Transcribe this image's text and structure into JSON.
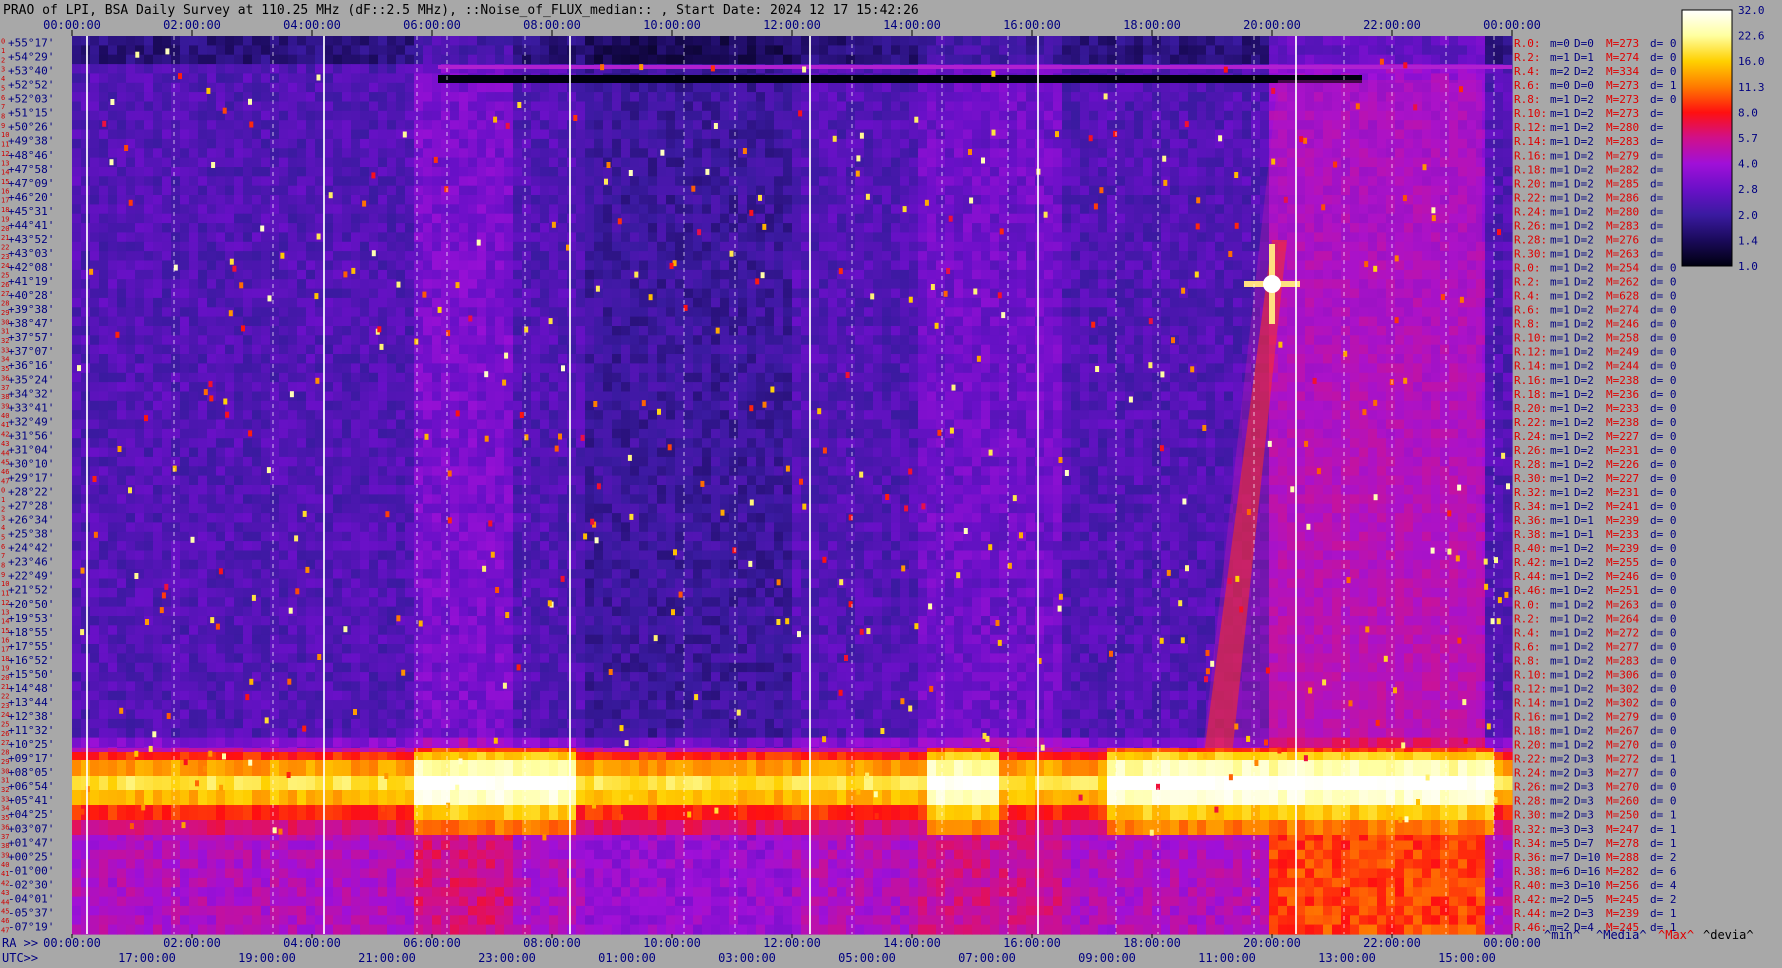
{
  "chart_data": {
    "type": "heatmap",
    "title": "PRAO of LPI, BSA Daily Survey at 110.25 MHz (dF::2.5 MHz), ::Noise_of_FLUX_median:: , Start Date: 2024 12 17 15:42:26",
    "x_ticks_top": [
      "00:00:00",
      "02:00:00",
      "04:00:00",
      "06:00:00",
      "08:00:00",
      "10:00:00",
      "12:00:00",
      "14:00:00",
      "16:00:00",
      "18:00:00",
      "20:00:00",
      "22:00:00",
      "00:00:00"
    ],
    "x_ticks_ra": [
      "00:00:00",
      "02:00:00",
      "04:00:00",
      "06:00:00",
      "08:00:00",
      "10:00:00",
      "12:00:00",
      "14:00:00",
      "16:00:00",
      "18:00:00",
      "20:00:00",
      "22:00:00",
      "00:00:00"
    ],
    "x_ticks_utc": [
      "17:00:00",
      "19:00:00",
      "21:00:00",
      "23:00:00",
      "01:00:00",
      "03:00:00",
      "05:00:00",
      "07:00:00",
      "09:00:00",
      "11:00:00",
      "13:00:00",
      "15:00:00"
    ],
    "ra_label": "RA >>",
    "utc_label": "UTC>>",
    "y_labels": [
      "+55°17'",
      "+54°29'",
      "+53°40'",
      "+52°52'",
      "+52°03'",
      "+51°15'",
      "+50°26'",
      "+49°38'",
      "+48°46'",
      "+47°58'",
      "+47°09'",
      "+46°20'",
      "+45°31'",
      "+44°41'",
      "+43°52'",
      "+43°03'",
      "+42°08'",
      "+41°19'",
      "+40°28'",
      "+39°38'",
      "+38°47'",
      "+37°57'",
      "+37°07'",
      "+36°16'",
      "+35°24'",
      "+34°32'",
      "+33°41'",
      "+32°49'",
      "+31°56'",
      "+31°04'",
      "+30°10'",
      "+29°17'",
      "+28°22'",
      "+27°28'",
      "+26°34'",
      "+25°38'",
      "+24°42'",
      "+23°46'",
      "+22°49'",
      "+21°52'",
      "+20°50'",
      "+19°53'",
      "+18°55'",
      "+17°55'",
      "+16°52'",
      "+15°50'",
      "+14°48'",
      "+13°44'",
      "+12°38'",
      "+11°32'",
      "+10°25'",
      "+09°17'",
      "+08°05'",
      "+06°54'",
      "+05°41'",
      "+04°25'",
      "+03°07'",
      "+01°47'",
      "+00°25'",
      "-01°00'",
      "-02°30'",
      "-04°01'",
      "-05°37'",
      "-07°19'"
    ],
    "row_index": [
      "0",
      "1",
      "2",
      "3",
      "4",
      "5",
      "6",
      "7",
      "8",
      "9",
      "10",
      "11",
      "12",
      "13",
      "14",
      "15",
      "16",
      "17",
      "18",
      "19",
      "20",
      "21",
      "22",
      "23",
      "24",
      "25",
      "26",
      "27",
      "28",
      "29",
      "30",
      "31",
      "32",
      "33",
      "34",
      "35",
      "36",
      "37",
      "38",
      "39",
      "40",
      "41",
      "42",
      "43",
      "44",
      "45",
      "46",
      "47",
      "0",
      "1",
      "2",
      "3",
      "4",
      "5",
      "6",
      "7",
      "8",
      "9",
      "10",
      "11",
      "12",
      "13",
      "14",
      "15",
      "16",
      "17",
      "18",
      "19",
      "20",
      "21",
      "22",
      "23",
      "24",
      "25",
      "26",
      "27",
      "28",
      "29",
      "30",
      "31",
      "32",
      "33",
      "34",
      "35",
      "36",
      "37",
      "38",
      "39",
      "40",
      "41",
      "42",
      "43",
      "44",
      "45",
      "46",
      "47"
    ],
    "stats": [
      {
        "r": "R.0:",
        "m": "m=0",
        "D": "D=0",
        "M": "M=273",
        "d": "d= 0"
      },
      {
        "r": "R.2:",
        "m": "m=1",
        "D": "D=1",
        "M": "M=274",
        "d": "d= 0"
      },
      {
        "r": "R.4:",
        "m": "m=2",
        "D": "D=2",
        "M": "M=334",
        "d": "d= 0"
      },
      {
        "r": "R.6:",
        "m": "m=0",
        "D": "D=0",
        "M": "M=273",
        "d": "d= 1"
      },
      {
        "r": "R.8:",
        "m": "m=1",
        "D": "D=2",
        "M": "M=273",
        "d": "d= 0"
      },
      {
        "r": "R.10:",
        "m": "m=1",
        "D": "D=2",
        "M": "M=273",
        "d": "d="
      },
      {
        "r": "R.12:",
        "m": "m=1",
        "D": "D=2",
        "M": "M=280",
        "d": "d="
      },
      {
        "r": "R.14:",
        "m": "m=1",
        "D": "D=2",
        "M": "M=283",
        "d": "d="
      },
      {
        "r": "R.16:",
        "m": "m=1",
        "D": "D=2",
        "M": "M=279",
        "d": "d="
      },
      {
        "r": "R.18:",
        "m": "m=1",
        "D": "D=2",
        "M": "M=282",
        "d": "d="
      },
      {
        "r": "R.20:",
        "m": "m=1",
        "D": "D=2",
        "M": "M=285",
        "d": "d="
      },
      {
        "r": "R.22:",
        "m": "m=1",
        "D": "D=2",
        "M": "M=286",
        "d": "d="
      },
      {
        "r": "R.24:",
        "m": "m=1",
        "D": "D=2",
        "M": "M=280",
        "d": "d="
      },
      {
        "r": "R.26:",
        "m": "m=1",
        "D": "D=2",
        "M": "M=283",
        "d": "d="
      },
      {
        "r": "R.28:",
        "m": "m=1",
        "D": "D=2",
        "M": "M=276",
        "d": "d="
      },
      {
        "r": "R.30:",
        "m": "m=1",
        "D": "D=2",
        "M": "M=263",
        "d": "d="
      },
      {
        "r": "R.0:",
        "m": "m=1",
        "D": "D=2",
        "M": "M=254",
        "d": "d= 0"
      },
      {
        "r": "R.2:",
        "m": "m=1",
        "D": "D=2",
        "M": "M=262",
        "d": "d= 0"
      },
      {
        "r": "R.4:",
        "m": "m=1",
        "D": "D=2",
        "M": "M=628",
        "d": "d= 0"
      },
      {
        "r": "R.6:",
        "m": "m=1",
        "D": "D=2",
        "M": "M=274",
        "d": "d= 0"
      },
      {
        "r": "R.8:",
        "m": "m=1",
        "D": "D=2",
        "M": "M=246",
        "d": "d= 0"
      },
      {
        "r": "R.10:",
        "m": "m=1",
        "D": "D=2",
        "M": "M=258",
        "d": "d= 0"
      },
      {
        "r": "R.12:",
        "m": "m=1",
        "D": "D=2",
        "M": "M=249",
        "d": "d= 0"
      },
      {
        "r": "R.14:",
        "m": "m=1",
        "D": "D=2",
        "M": "M=244",
        "d": "d= 0"
      },
      {
        "r": "R.16:",
        "m": "m=1",
        "D": "D=2",
        "M": "M=238",
        "d": "d= 0"
      },
      {
        "r": "R.18:",
        "m": "m=1",
        "D": "D=2",
        "M": "M=236",
        "d": "d= 0"
      },
      {
        "r": "R.20:",
        "m": "m=1",
        "D": "D=2",
        "M": "M=233",
        "d": "d= 0"
      },
      {
        "r": "R.22:",
        "m": "m=1",
        "D": "D=2",
        "M": "M=238",
        "d": "d= 0"
      },
      {
        "r": "R.24:",
        "m": "m=1",
        "D": "D=2",
        "M": "M=227",
        "d": "d= 0"
      },
      {
        "r": "R.26:",
        "m": "m=1",
        "D": "D=2",
        "M": "M=231",
        "d": "d= 0"
      },
      {
        "r": "R.28:",
        "m": "m=1",
        "D": "D=2",
        "M": "M=226",
        "d": "d= 0"
      },
      {
        "r": "R.30:",
        "m": "m=1",
        "D": "D=2",
        "M": "M=227",
        "d": "d= 0"
      },
      {
        "r": "R.32:",
        "m": "m=1",
        "D": "D=2",
        "M": "M=231",
        "d": "d= 0"
      },
      {
        "r": "R.34:",
        "m": "m=1",
        "D": "D=2",
        "M": "M=241",
        "d": "d= 0"
      },
      {
        "r": "R.36:",
        "m": "m=1",
        "D": "D=1",
        "M": "M=239",
        "d": "d= 0"
      },
      {
        "r": "R.38:",
        "m": "m=1",
        "D": "D=1",
        "M": "M=233",
        "d": "d= 0"
      },
      {
        "r": "R.40:",
        "m": "m=1",
        "D": "D=2",
        "M": "M=239",
        "d": "d= 0"
      },
      {
        "r": "R.42:",
        "m": "m=1",
        "D": "D=2",
        "M": "M=255",
        "d": "d= 0"
      },
      {
        "r": "R.44:",
        "m": "m=1",
        "D": "D=2",
        "M": "M=246",
        "d": "d= 0"
      },
      {
        "r": "R.46:",
        "m": "m=1",
        "D": "D=2",
        "M": "M=251",
        "d": "d= 0"
      },
      {
        "r": "R.0:",
        "m": "m=1",
        "D": "D=2",
        "M": "M=263",
        "d": "d= 0"
      },
      {
        "r": "R.2:",
        "m": "m=1",
        "D": "D=2",
        "M": "M=264",
        "d": "d= 0"
      },
      {
        "r": "R.4:",
        "m": "m=1",
        "D": "D=2",
        "M": "M=272",
        "d": "d= 0"
      },
      {
        "r": "R.6:",
        "m": "m=1",
        "D": "D=2",
        "M": "M=277",
        "d": "d= 0"
      },
      {
        "r": "R.8:",
        "m": "m=1",
        "D": "D=2",
        "M": "M=283",
        "d": "d= 0"
      },
      {
        "r": "R.10:",
        "m": "m=1",
        "D": "D=2",
        "M": "M=306",
        "d": "d= 0"
      },
      {
        "r": "R.12:",
        "m": "m=1",
        "D": "D=2",
        "M": "M=302",
        "d": "d= 0"
      },
      {
        "r": "R.14:",
        "m": "m=1",
        "D": "D=2",
        "M": "M=302",
        "d": "d= 0"
      },
      {
        "r": "R.16:",
        "m": "m=1",
        "D": "D=2",
        "M": "M=279",
        "d": "d= 0"
      },
      {
        "r": "R.18:",
        "m": "m=1",
        "D": "D=2",
        "M": "M=267",
        "d": "d= 0"
      },
      {
        "r": "R.20:",
        "m": "m=1",
        "D": "D=2",
        "M": "M=270",
        "d": "d= 0"
      },
      {
        "r": "R.22:",
        "m": "m=2",
        "D": "D=3",
        "M": "M=272",
        "d": "d= 1"
      },
      {
        "r": "R.24:",
        "m": "m=2",
        "D": "D=3",
        "M": "M=277",
        "d": "d= 0"
      },
      {
        "r": "R.26:",
        "m": "m=2",
        "D": "D=3",
        "M": "M=270",
        "d": "d= 0"
      },
      {
        "r": "R.28:",
        "m": "m=2",
        "D": "D=3",
        "M": "M=260",
        "d": "d= 0"
      },
      {
        "r": "R.30:",
        "m": "m=2",
        "D": "D=3",
        "M": "M=250",
        "d": "d= 1"
      },
      {
        "r": "R.32:",
        "m": "m=3",
        "D": "D=3",
        "M": "M=247",
        "d": "d= 1"
      },
      {
        "r": "R.34:",
        "m": "m=5",
        "D": "D=7",
        "M": "M=278",
        "d": "d= 1"
      },
      {
        "r": "R.36:",
        "m": "m=7",
        "D": "D=10",
        "M": "M=288",
        "d": "d= 2"
      },
      {
        "r": "R.38:",
        "m": "m=6",
        "D": "D=16",
        "M": "M=282",
        "d": "d= 6"
      },
      {
        "r": "R.40:",
        "m": "m=3",
        "D": "D=10",
        "M": "M=256",
        "d": "d= 4"
      },
      {
        "r": "R.42:",
        "m": "m=2",
        "D": "D=5",
        "M": "M=245",
        "d": "d= 2"
      },
      {
        "r": "R.44:",
        "m": "m=2",
        "D": "D=3",
        "M": "M=239",
        "d": "d= 1"
      },
      {
        "r": "R.46:",
        "m": "m=2",
        "D": "D=4",
        "M": "M=245",
        "d": "d= 1"
      }
    ],
    "colorbar_ticks": [
      "32.0",
      "22.6",
      "16.0",
      "11.3",
      "8.0",
      "5.7",
      "4.0",
      "2.8",
      "2.0",
      "1.4",
      "1.0"
    ],
    "footer_legend": {
      "min": "^min^",
      "median": "^Media^",
      "max": "^Max^",
      "devia": "^devia^"
    },
    "colormap": [
      "#000010",
      "#1a0a5a",
      "#3a1aa0",
      "#6a10c8",
      "#a010d8",
      "#d0108a",
      "#ff1010",
      "#ff7a00",
      "#ffd000",
      "#ffffa0",
      "#ffffff"
    ],
    "label_color_stat_r": "#e00000",
    "label_color_stat_max": "#e00000",
    "label_color_stat_other": "#000080",
    "label_color_decl": "#000080",
    "label_color_index": "#d00000"
  }
}
